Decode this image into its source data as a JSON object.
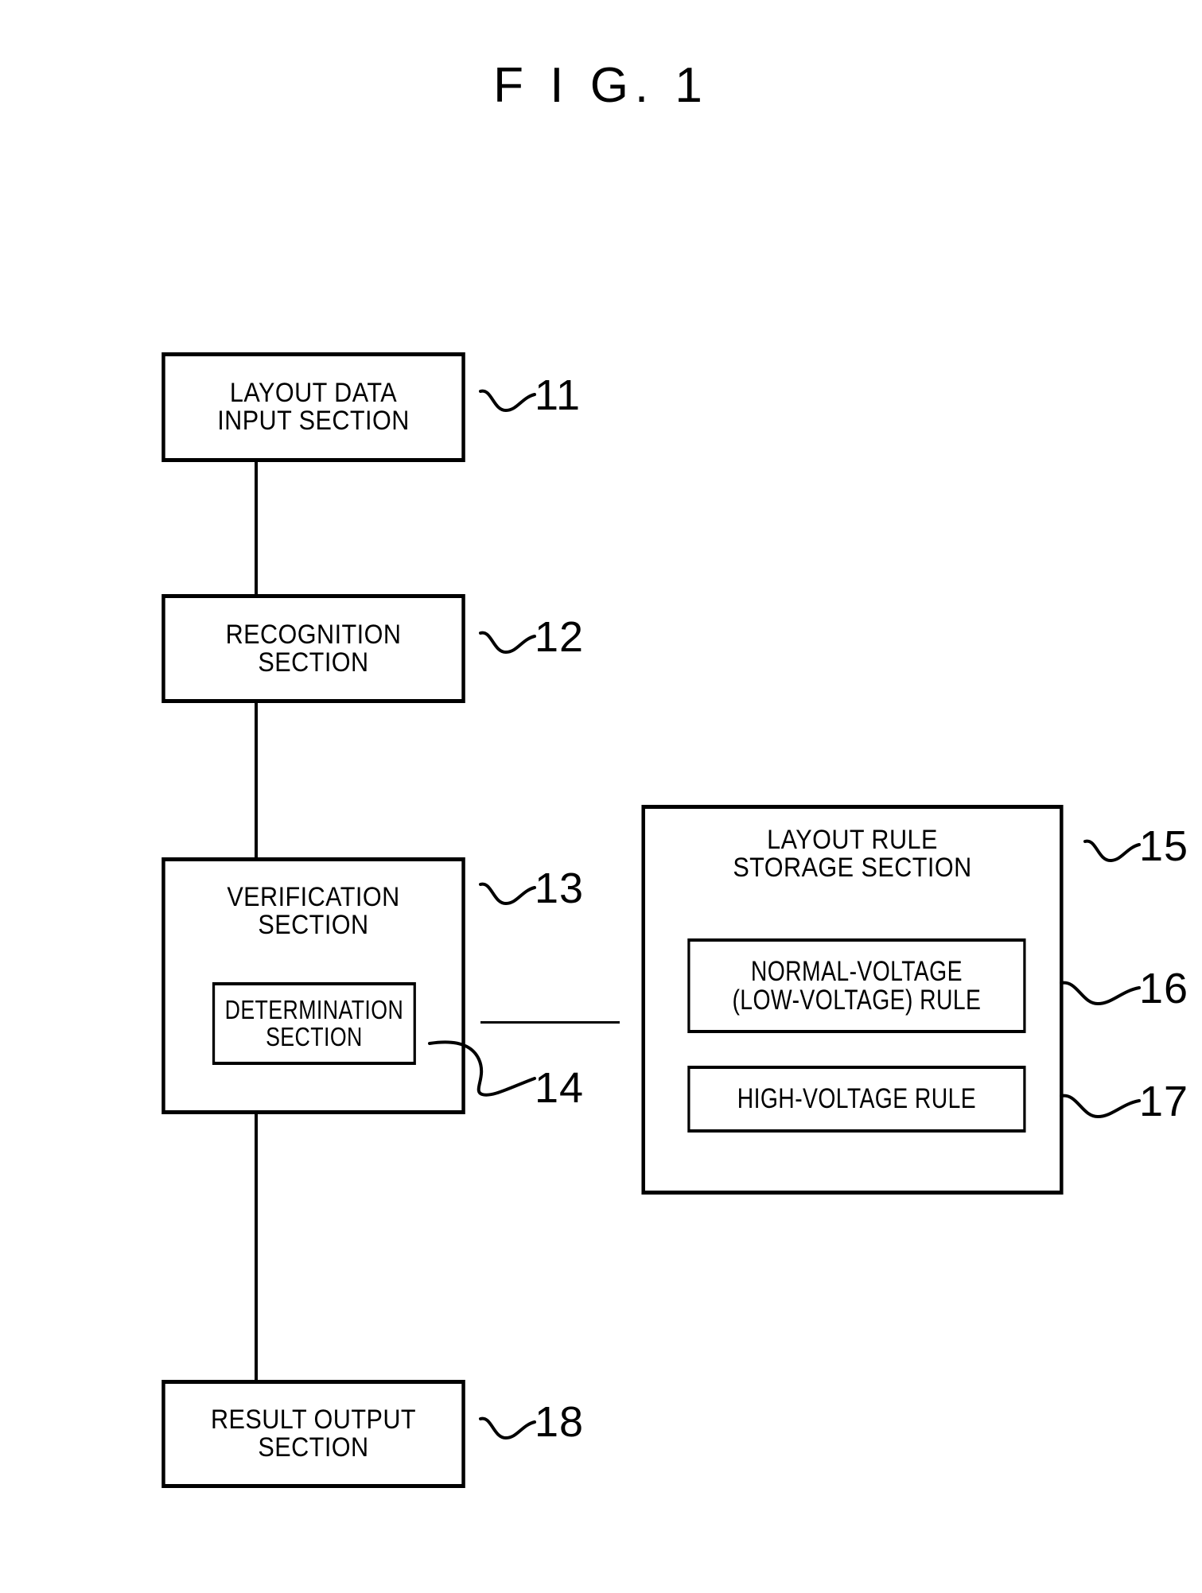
{
  "figure": {
    "title": "F I G. 1"
  },
  "nodes": [
    {
      "ref": "11",
      "name": "layout-data-input-section",
      "lines": [
        "LAYOUT DATA",
        "INPUT SECTION"
      ]
    },
    {
      "ref": "12",
      "name": "recognition-section",
      "lines": [
        "RECOGNITION",
        "SECTION"
      ]
    },
    {
      "ref": "13",
      "name": "verification-section",
      "lines": [
        "VERIFICATION",
        "SECTION"
      ]
    },
    {
      "ref": "14",
      "name": "determination-section",
      "lines": [
        "DETERMINATION",
        "SECTION"
      ]
    },
    {
      "ref": "15",
      "name": "layout-rule-storage-section",
      "lines": [
        "LAYOUT RULE",
        "STORAGE SECTION"
      ]
    },
    {
      "ref": "16",
      "name": "normal-voltage-rule",
      "lines": [
        "NORMAL-VOLTAGE",
        "(LOW-VOLTAGE) RULE"
      ]
    },
    {
      "ref": "17",
      "name": "high-voltage-rule",
      "lines": [
        "HIGH-VOLTAGE RULE"
      ]
    },
    {
      "ref": "18",
      "name": "result-output-section",
      "lines": [
        "RESULT OUTPUT",
        "SECTION"
      ]
    }
  ],
  "colors": {
    "ink": "#000000",
    "paper": "#ffffff"
  }
}
